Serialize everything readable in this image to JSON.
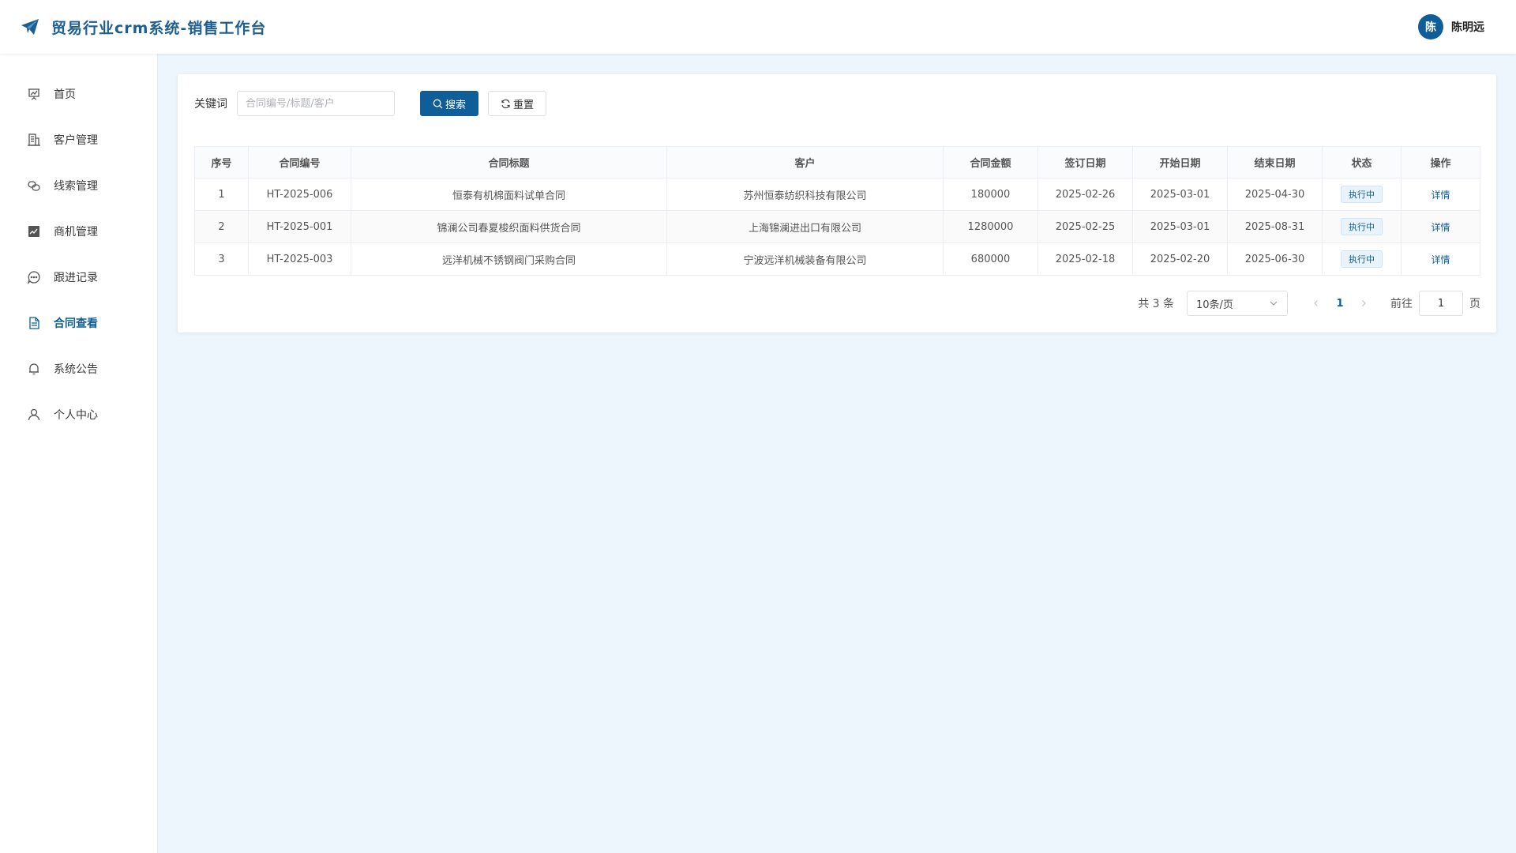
{
  "header": {
    "title": "贸易行业crm系统-销售工作台",
    "user": {
      "avatar_text": "陈",
      "name": "陈明远"
    }
  },
  "sidebar": {
    "items": [
      {
        "label": "首页",
        "icon": "presentation-chart-icon",
        "active": false
      },
      {
        "label": "客户管理",
        "icon": "building-icon",
        "active": false
      },
      {
        "label": "线索管理",
        "icon": "link-chain-icon",
        "active": false
      },
      {
        "label": "商机管理",
        "icon": "trend-chart-icon",
        "active": false
      },
      {
        "label": "跟进记录",
        "icon": "chat-bubble-icon",
        "active": false
      },
      {
        "label": "合同查看",
        "icon": "document-icon",
        "active": true
      },
      {
        "label": "系统公告",
        "icon": "bell-icon",
        "active": false
      },
      {
        "label": "个人中心",
        "icon": "user-icon",
        "active": false
      }
    ]
  },
  "filter": {
    "keyword_label": "关键词",
    "keyword_placeholder": "合同编号/标题/客户",
    "keyword_value": "",
    "search_label": "搜索",
    "reset_label": "重置"
  },
  "table": {
    "columns": [
      "序号",
      "合同编号",
      "合同标题",
      "客户",
      "合同金额",
      "签订日期",
      "开始日期",
      "结束日期",
      "状态",
      "操作"
    ],
    "rows": [
      {
        "index": "1",
        "code": "HT-2025-006",
        "title": "恒泰有机棉面料试单合同",
        "customer": "苏州恒泰纺织科技有限公司",
        "amount": "180000",
        "sign_date": "2025-02-26",
        "start_date": "2025-03-01",
        "end_date": "2025-04-30",
        "status": "执行中",
        "action": "详情"
      },
      {
        "index": "2",
        "code": "HT-2025-001",
        "title": "锦澜公司春夏梭织面料供货合同",
        "customer": "上海锦澜进出口有限公司",
        "amount": "1280000",
        "sign_date": "2025-02-25",
        "start_date": "2025-03-01",
        "end_date": "2025-08-31",
        "status": "执行中",
        "action": "详情"
      },
      {
        "index": "3",
        "code": "HT-2025-003",
        "title": "远洋机械不锈钢阀门采购合同",
        "customer": "宁波远洋机械装备有限公司",
        "amount": "680000",
        "sign_date": "2025-02-18",
        "start_date": "2025-02-20",
        "end_date": "2025-06-30",
        "status": "执行中",
        "action": "详情"
      }
    ]
  },
  "pagination": {
    "total_text": "共 3 条",
    "page_size": "10条/页",
    "current_page": "1",
    "goto_prefix": "前往",
    "goto_value": "1",
    "goto_suffix": "页"
  },
  "colors": {
    "primary": "#0f5e98",
    "title": "#1d5f93",
    "background": "#eef6fd"
  }
}
